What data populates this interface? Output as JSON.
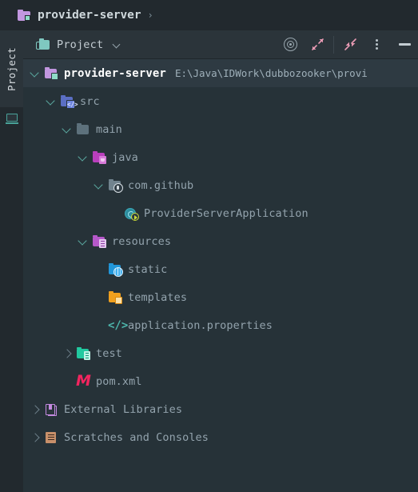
{
  "breadcrumb": {
    "icon": "module-folder-icon",
    "project_name": "provider-server",
    "separator": "›"
  },
  "sidebar": {
    "tab_label": "Project",
    "tool_icon": "monitor-icon"
  },
  "tool_window": {
    "tab_label": "Project",
    "tab_icon": "folders-icon",
    "dropdown_icon": "chevron-down-icon",
    "actions": [
      {
        "name": "select-opened-file-button",
        "icon": "target-icon",
        "label": ""
      },
      {
        "name": "expand-all-button",
        "icon": "expand-arrows-icon",
        "label": ""
      },
      {
        "name": "collapse-all-button",
        "icon": "collapse-arrows-icon",
        "label": ""
      },
      {
        "name": "options-menu-button",
        "icon": "vertical-dots-icon",
        "label": ""
      },
      {
        "name": "hide-button",
        "icon": "minus-icon",
        "label": ""
      }
    ]
  },
  "tree": {
    "nodes": [
      {
        "name": "provider-server",
        "detail": "E:\\Java\\IDWork\\dubbozooker\\provi",
        "indent": 0,
        "twisty": "expanded",
        "icon": "ic-root",
        "icon_name": "module-folder-icon",
        "selected": true,
        "bold": true
      },
      {
        "name": "src",
        "detail": "",
        "indent": 1,
        "twisty": "expanded",
        "icon": "ic-src",
        "icon_name": "source-folder-icon",
        "selected": false,
        "bold": false
      },
      {
        "name": "main",
        "detail": "",
        "indent": 2,
        "twisty": "expanded",
        "icon": "ic-main",
        "icon_name": "folder-icon",
        "selected": false,
        "bold": false
      },
      {
        "name": "java",
        "detail": "",
        "indent": 3,
        "twisty": "expanded",
        "icon": "ic-java",
        "icon_name": "java-source-root-icon",
        "selected": false,
        "bold": false
      },
      {
        "name": "com.github",
        "detail": "",
        "indent": 4,
        "twisty": "expanded",
        "icon": "ic-pkg",
        "icon_name": "package-icon",
        "selected": false,
        "bold": false
      },
      {
        "name": "ProviderServerApplication",
        "detail": "",
        "indent": 5,
        "twisty": "none",
        "icon": "ic-class",
        "icon_name": "runnable-class-icon",
        "selected": false,
        "bold": false
      },
      {
        "name": "resources",
        "detail": "",
        "indent": 3,
        "twisty": "expanded",
        "icon": "ic-res",
        "icon_name": "resources-root-icon",
        "selected": false,
        "bold": false
      },
      {
        "name": "static",
        "detail": "",
        "indent": 4,
        "twisty": "none",
        "icon": "ic-static",
        "icon_name": "web-folder-icon",
        "selected": false,
        "bold": false
      },
      {
        "name": "templates",
        "detail": "",
        "indent": 4,
        "twisty": "none",
        "icon": "ic-tpl",
        "icon_name": "templates-folder-icon",
        "selected": false,
        "bold": false
      },
      {
        "name": "application.properties",
        "detail": "",
        "indent": 4,
        "twisty": "none",
        "icon": "ic-code",
        "icon_name": "properties-file-icon",
        "glyph": "</>",
        "selected": false,
        "bold": false
      },
      {
        "name": "test",
        "detail": "",
        "indent": 2,
        "twisty": "collapsed",
        "icon": "ic-test",
        "icon_name": "test-folder-icon",
        "selected": false,
        "bold": false
      },
      {
        "name": "pom.xml",
        "detail": "",
        "indent": 2,
        "twisty": "none",
        "icon": "ic-maven",
        "icon_name": "maven-file-icon",
        "glyph": "M",
        "selected": false,
        "bold": false
      },
      {
        "name": "External Libraries",
        "detail": "",
        "indent": 0,
        "twisty": "collapsed",
        "icon": "ic-lib",
        "icon_name": "library-icon",
        "selected": false,
        "bold": false
      },
      {
        "name": "Scratches and Consoles",
        "detail": "",
        "indent": 0,
        "twisty": "collapsed",
        "icon": "ic-scratch",
        "icon_name": "scratches-icon",
        "selected": false,
        "bold": false
      }
    ]
  },
  "colors": {
    "background": "#263238",
    "header_background": "#2b343a",
    "breadcrumb_background": "#22292e",
    "selection": "#2e3a42",
    "text": "#93a3ad",
    "text_bold": "#ffffff",
    "accent_teal": "#5ba9a0"
  }
}
